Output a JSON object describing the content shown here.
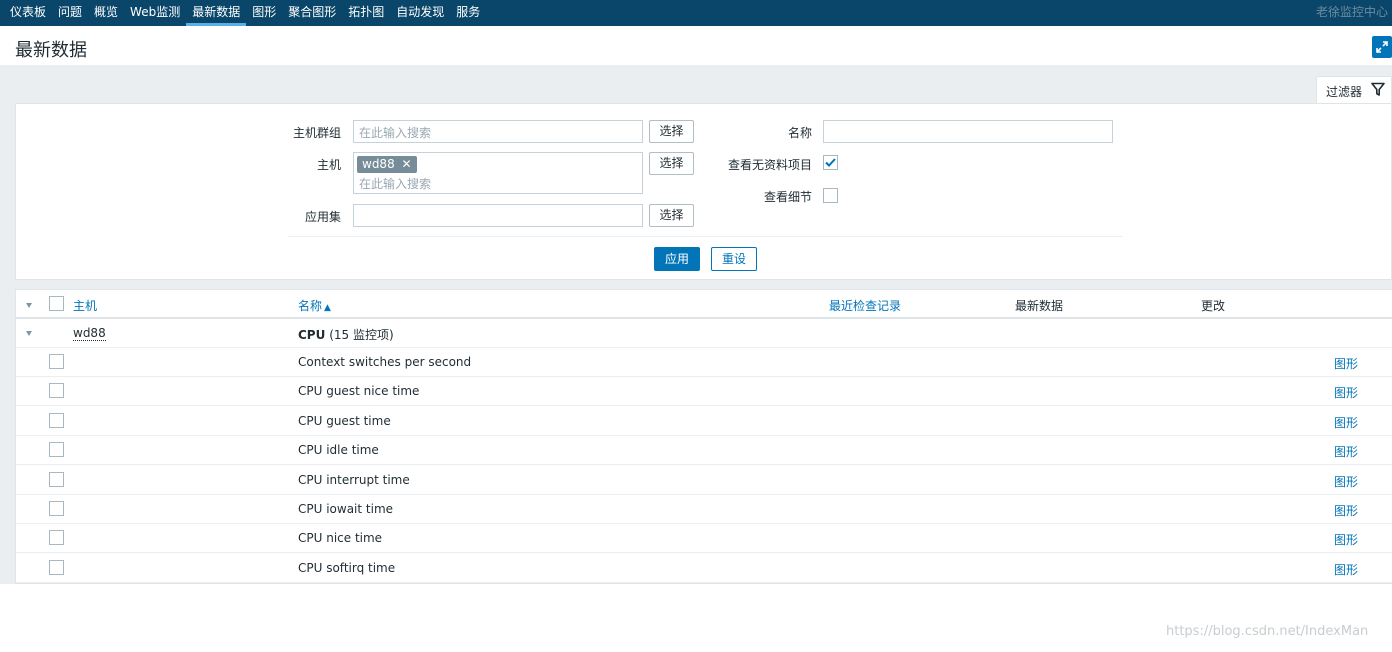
{
  "nav": {
    "items": [
      "仪表板",
      "问题",
      "概览",
      "Web监测",
      "最新数据",
      "图形",
      "聚合图形",
      "拓扑图",
      "自动发现",
      "服务"
    ],
    "active_index": 4,
    "user_text": "老徐监控中心"
  },
  "page": {
    "title": "最新数据"
  },
  "filter": {
    "tab_label": "过滤器",
    "host_group": {
      "label": "主机群组",
      "placeholder": "在此输入搜索",
      "select_label": "选择"
    },
    "host": {
      "label": "主机",
      "tag": "wd88",
      "placeholder": "在此输入搜索",
      "select_label": "选择"
    },
    "application": {
      "label": "应用集",
      "value": "",
      "select_label": "选择"
    },
    "name": {
      "label": "名称",
      "value": ""
    },
    "show_no_data": {
      "label": "查看无资料项目",
      "checked": true
    },
    "show_details": {
      "label": "查看细节",
      "checked": false
    },
    "apply_label": "应用",
    "reset_label": "重设"
  },
  "table": {
    "columns": {
      "host": "主机",
      "name": "名称",
      "last_check": "最近检查记录",
      "last_value": "最新数据",
      "change": "更改"
    },
    "group": {
      "host": "wd88",
      "app": "CPU",
      "count_text": "(15 监控项)"
    },
    "graph_label": "图形",
    "rows": [
      "Context switches per second",
      "CPU guest nice time",
      "CPU guest time",
      "CPU idle time",
      "CPU interrupt time",
      "CPU iowait time",
      "CPU nice time",
      "CPU softirq time"
    ]
  },
  "watermark": "https://blog.csdn.net/IndexMan"
}
